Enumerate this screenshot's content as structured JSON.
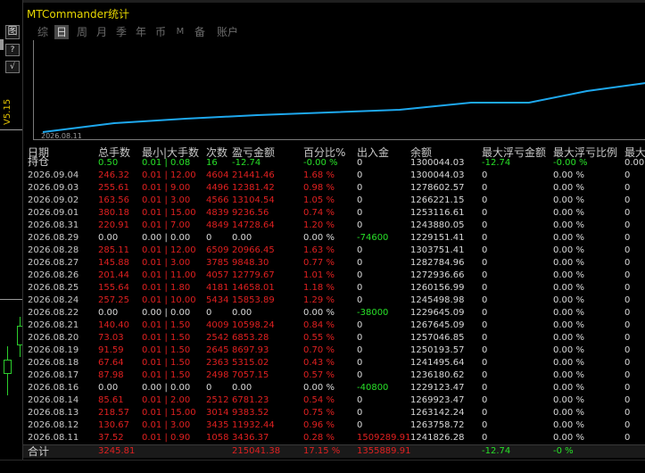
{
  "left": {
    "btn_top": "图",
    "btn_help": "?",
    "btn_check": "√",
    "version": "V5.15"
  },
  "window": {
    "title": "MTCommander统计"
  },
  "tabs": [
    {
      "label": "综",
      "active": false
    },
    {
      "label": "日",
      "active": true
    },
    {
      "label": "周",
      "active": false
    },
    {
      "label": "月",
      "active": false
    },
    {
      "label": "季",
      "active": false
    },
    {
      "label": "年",
      "active": false
    },
    {
      "label": "币",
      "active": false
    },
    {
      "label": "M",
      "active": false
    },
    {
      "label": "备",
      "active": false
    },
    {
      "label": "账户",
      "active": false
    }
  ],
  "chart": {
    "start_label": "2026.08.11",
    "line_color": "#1ea8ee",
    "series": [
      1241826.28,
      1258,
      1263,
      1267,
      1272,
      1276,
      1281,
      1286,
      1291,
      1295,
      1299,
      1300044.03
    ]
  },
  "columns": [
    "日期",
    "总手数",
    "最小|大手数",
    "次数",
    "盈亏金额",
    "百分比%",
    "出入金",
    "余额",
    "最大浮亏金额",
    "最大浮亏比例",
    "最大"
  ],
  "holding": {
    "label": "持仓",
    "lots": "0.50",
    "minmax": "0.01 | 0.08",
    "count": "16",
    "pnl": "-12.74",
    "pct": "-0.00 %",
    "flow": "0",
    "balance": "1300044.03",
    "max_float": "-12.74",
    "max_float_pct": "-0.00 %",
    "last": "0.00"
  },
  "rows": [
    {
      "date": "2026.09.04",
      "lots": "246.32",
      "minmax": "0.01 | 12.00",
      "count": "4604",
      "pnl": "21441.46",
      "pct": "1.68 %",
      "flow": "0",
      "balance": "1300044.03",
      "max_float": "0",
      "max_float_pct": "0.00 %",
      "last": "0",
      "kind": "red"
    },
    {
      "date": "2026.09.03",
      "lots": "255.61",
      "minmax": "0.01 | 9.00",
      "count": "4496",
      "pnl": "12381.42",
      "pct": "0.98 %",
      "flow": "0",
      "balance": "1278602.57",
      "max_float": "0",
      "max_float_pct": "0.00 %",
      "last": "0",
      "kind": "red"
    },
    {
      "date": "2026.09.02",
      "lots": "163.56",
      "minmax": "0.01 | 3.00",
      "count": "4566",
      "pnl": "13104.54",
      "pct": "1.05 %",
      "flow": "0",
      "balance": "1266221.15",
      "max_float": "0",
      "max_float_pct": "0.00 %",
      "last": "0",
      "kind": "red"
    },
    {
      "date": "2026.09.01",
      "lots": "380.18",
      "minmax": "0.01 | 15.00",
      "count": "4839",
      "pnl": "9236.56",
      "pct": "0.74 %",
      "flow": "0",
      "balance": "1253116.61",
      "max_float": "0",
      "max_float_pct": "0.00 %",
      "last": "0",
      "kind": "red"
    },
    {
      "date": "2026.08.31",
      "lots": "220.91",
      "minmax": "0.01 | 7.00",
      "count": "4849",
      "pnl": "14728.64",
      "pct": "1.20 %",
      "flow": "0",
      "balance": "1243880.05",
      "max_float": "0",
      "max_float_pct": "0.00 %",
      "last": "0",
      "kind": "red"
    },
    {
      "date": "2026.08.29",
      "lots": "0.00",
      "minmax": "0.00 | 0.00",
      "count": "0",
      "pnl": "0.00",
      "pct": "0.00 %",
      "flow": "-74600",
      "balance": "1229151.41",
      "max_float": "0",
      "max_float_pct": "0.00 %",
      "last": "0",
      "kind": "white"
    },
    {
      "date": "2026.08.28",
      "lots": "285.11",
      "minmax": "0.01 | 12.00",
      "count": "6509",
      "pnl": "20966.45",
      "pct": "1.63 %",
      "flow": "0",
      "balance": "1303751.41",
      "max_float": "0",
      "max_float_pct": "0.00 %",
      "last": "0",
      "kind": "red"
    },
    {
      "date": "2026.08.27",
      "lots": "145.88",
      "minmax": "0.01 | 3.00",
      "count": "3785",
      "pnl": "9848.30",
      "pct": "0.77 %",
      "flow": "0",
      "balance": "1282784.96",
      "max_float": "0",
      "max_float_pct": "0.00 %",
      "last": "0",
      "kind": "red"
    },
    {
      "date": "2026.08.26",
      "lots": "201.44",
      "minmax": "0.01 | 11.00",
      "count": "4057",
      "pnl": "12779.67",
      "pct": "1.01 %",
      "flow": "0",
      "balance": "1272936.66",
      "max_float": "0",
      "max_float_pct": "0.00 %",
      "last": "0",
      "kind": "red"
    },
    {
      "date": "2026.08.25",
      "lots": "155.64",
      "minmax": "0.01 | 1.80",
      "count": "4181",
      "pnl": "14658.01",
      "pct": "1.18 %",
      "flow": "0",
      "balance": "1260156.99",
      "max_float": "0",
      "max_float_pct": "0.00 %",
      "last": "0",
      "kind": "red"
    },
    {
      "date": "2026.08.24",
      "lots": "257.25",
      "minmax": "0.01 | 10.00",
      "count": "5434",
      "pnl": "15853.89",
      "pct": "1.29 %",
      "flow": "0",
      "balance": "1245498.98",
      "max_float": "0",
      "max_float_pct": "0.00 %",
      "last": "0",
      "kind": "red"
    },
    {
      "date": "2026.08.22",
      "lots": "0.00",
      "minmax": "0.00 | 0.00",
      "count": "0",
      "pnl": "0.00",
      "pct": "0.00 %",
      "flow": "-38000",
      "balance": "1229645.09",
      "max_float": "0",
      "max_float_pct": "0.00 %",
      "last": "0",
      "kind": "white"
    },
    {
      "date": "2026.08.21",
      "lots": "140.40",
      "minmax": "0.01 | 1.50",
      "count": "4009",
      "pnl": "10598.24",
      "pct": "0.84 %",
      "flow": "0",
      "balance": "1267645.09",
      "max_float": "0",
      "max_float_pct": "0.00 %",
      "last": "0",
      "kind": "red"
    },
    {
      "date": "2026.08.20",
      "lots": "73.03",
      "minmax": "0.01 | 1.50",
      "count": "2542",
      "pnl": "6853.28",
      "pct": "0.55 %",
      "flow": "0",
      "balance": "1257046.85",
      "max_float": "0",
      "max_float_pct": "0.00 %",
      "last": "0",
      "kind": "red"
    },
    {
      "date": "2026.08.19",
      "lots": "91.59",
      "minmax": "0.01 | 1.50",
      "count": "2645",
      "pnl": "8697.93",
      "pct": "0.70 %",
      "flow": "0",
      "balance": "1250193.57",
      "max_float": "0",
      "max_float_pct": "0.00 %",
      "last": "0",
      "kind": "red"
    },
    {
      "date": "2026.08.18",
      "lots": "67.64",
      "minmax": "0.01 | 1.50",
      "count": "2363",
      "pnl": "5315.02",
      "pct": "0.43 %",
      "flow": "0",
      "balance": "1241495.64",
      "max_float": "0",
      "max_float_pct": "0.00 %",
      "last": "0",
      "kind": "red"
    },
    {
      "date": "2026.08.17",
      "lots": "87.98",
      "minmax": "0.01 | 1.50",
      "count": "2498",
      "pnl": "7057.15",
      "pct": "0.57 %",
      "flow": "0",
      "balance": "1236180.62",
      "max_float": "0",
      "max_float_pct": "0.00 %",
      "last": "0",
      "kind": "red"
    },
    {
      "date": "2026.08.16",
      "lots": "0.00",
      "minmax": "0.00 | 0.00",
      "count": "0",
      "pnl": "0.00",
      "pct": "0.00 %",
      "flow": "-40800",
      "balance": "1229123.47",
      "max_float": "0",
      "max_float_pct": "0.00 %",
      "last": "0",
      "kind": "white"
    },
    {
      "date": "2026.08.14",
      "lots": "85.61",
      "minmax": "0.01 | 2.00",
      "count": "2512",
      "pnl": "6781.23",
      "pct": "0.54 %",
      "flow": "0",
      "balance": "1269923.47",
      "max_float": "0",
      "max_float_pct": "0.00 %",
      "last": "0",
      "kind": "red"
    },
    {
      "date": "2026.08.13",
      "lots": "218.57",
      "minmax": "0.01 | 15.00",
      "count": "3014",
      "pnl": "9383.52",
      "pct": "0.75 %",
      "flow": "0",
      "balance": "1263142.24",
      "max_float": "0",
      "max_float_pct": "0.00 %",
      "last": "0",
      "kind": "red"
    },
    {
      "date": "2026.08.12",
      "lots": "130.67",
      "minmax": "0.01 | 3.00",
      "count": "3435",
      "pnl": "11932.44",
      "pct": "0.96 %",
      "flow": "0",
      "balance": "1263758.72",
      "max_float": "0",
      "max_float_pct": "0.00 %",
      "last": "0",
      "kind": "red"
    },
    {
      "date": "2026.08.11",
      "lots": "37.52",
      "minmax": "0.01 | 0.90",
      "count": "1058",
      "pnl": "3436.37",
      "pct": "0.28 %",
      "flow": "1509289.91",
      "balance": "1241826.28",
      "max_float": "0",
      "max_float_pct": "0.00 %",
      "last": "0",
      "kind": "red",
      "flow_red": true
    }
  ],
  "total": {
    "label": "合计",
    "lots": "3245.81",
    "pnl": "215041.38",
    "pct": "17.15 %",
    "flow": "1355889.91",
    "max_float": "-12.74",
    "max_float_pct": "-0 %"
  },
  "colors": {
    "red": "#e02020",
    "green": "#28e028",
    "accent": "#1ea8ee",
    "title": "#e8d800"
  }
}
